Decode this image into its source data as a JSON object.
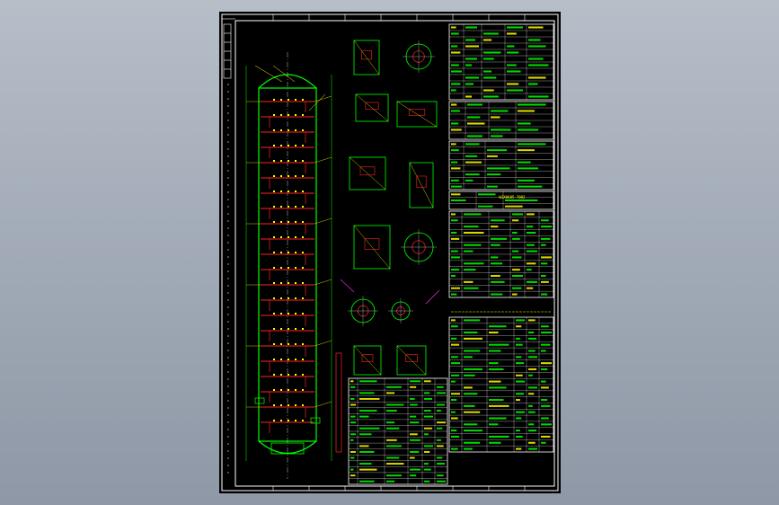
{
  "viewport": {
    "background_top": "#b6bec8",
    "background_bottom": "#8e98a6"
  },
  "drawing": {
    "paper_color": "#000000",
    "frame_color": "#ffffff",
    "colors": {
      "column_shell": "#00ff00",
      "tray_lines": "#ff2222",
      "leader_lines": "#ffff00",
      "table_grid": "#ffffff",
      "table_text": "#00ff00",
      "accent_magenta": "#ff33ff"
    },
    "table_top_code": "WJX0685-7002"
  }
}
